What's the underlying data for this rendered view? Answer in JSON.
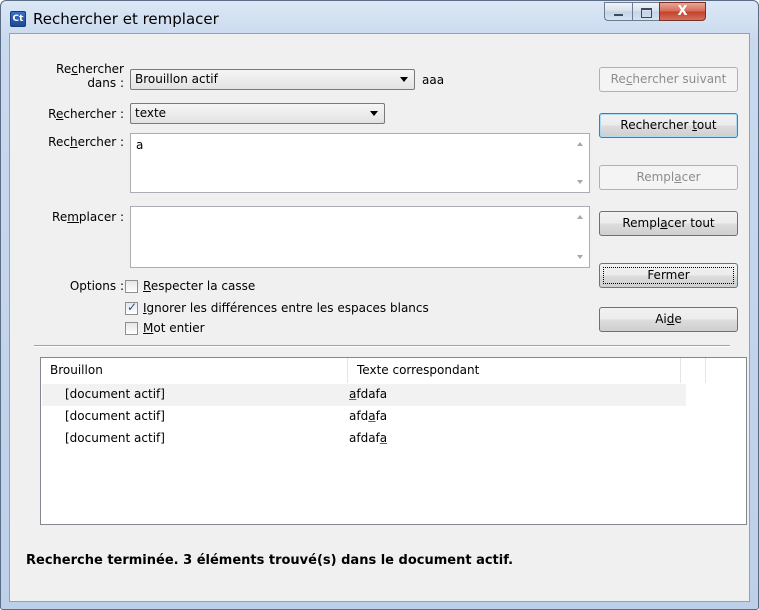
{
  "window": {
    "icon_text": "Ct",
    "title": "Rechercher et remplacer",
    "close_glyph": "X"
  },
  "form": {
    "search_in_label": [
      "Re",
      "c",
      "hercher",
      "dans :"
    ],
    "search_in_value": "Brouillon actif",
    "search_in_extra": "aaa",
    "search_type_label": [
      "R",
      "e",
      "chercher :"
    ],
    "search_type_value": "texte",
    "search_text_label": [
      "Rec",
      "h",
      "ercher :"
    ],
    "search_text_value": "a",
    "replace_label": [
      "Re",
      "m",
      "placer :"
    ],
    "replace_value": "",
    "options_label": "Options :",
    "options": [
      {
        "pre": "",
        "key": "R",
        "post": "especter la casse",
        "checked": false
      },
      {
        "pre": "",
        "key": "I",
        "post": "gnorer les différences entre les espaces blancs",
        "checked": true
      },
      {
        "pre": "",
        "key": "M",
        "post": "ot entier",
        "checked": false
      }
    ]
  },
  "buttons": {
    "find_next": {
      "pre": "Re",
      "key": "c",
      "post": "hercher suivant"
    },
    "find_all": {
      "pre": "Rechercher ",
      "key": "t",
      "post": "out"
    },
    "replace": {
      "pre": "Rempl",
      "key": "a",
      "post": "cer"
    },
    "replace_all": {
      "pre": "Rempl",
      "key": "a",
      "post": "cer tout"
    },
    "close": {
      "label": "Fermer"
    },
    "help": {
      "pre": "Ai",
      "key": "d",
      "post": "e"
    }
  },
  "results": {
    "columns": [
      "Brouillon",
      "Texte correspondant"
    ],
    "rows": [
      {
        "draft": "[document actif]",
        "pre": "",
        "match": "a",
        "post": "fdafa"
      },
      {
        "draft": "[document actif]",
        "pre": "afd",
        "match": "a",
        "post": "fa"
      },
      {
        "draft": "[document actif]",
        "pre": "afdaf",
        "match": "a",
        "post": ""
      }
    ]
  },
  "status_text": "Recherche terminée. 3 éléments trouvé(s) dans le document actif."
}
